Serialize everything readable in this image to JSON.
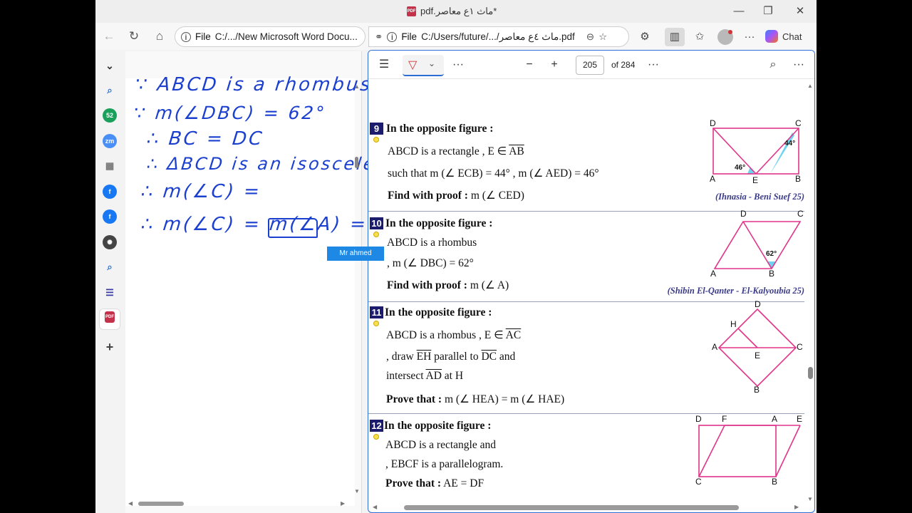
{
  "window": {
    "title": "pdf.ماث ١ع معاصر*",
    "controls": {
      "minimize": "—",
      "restore": "❐",
      "close": "✕"
    }
  },
  "tabs": {
    "left": {
      "scheme": "File",
      "address": "C:/.../New Microsoft Word Docu..."
    },
    "right": {
      "scheme": "File",
      "address": "C:/Users/future/.../ماث ٤ع معاصر.pdf"
    }
  },
  "toolbar": {
    "chat_label": "Chat"
  },
  "sidebar": {
    "items": [
      {
        "icon": "search-icon",
        "color": "#2b6fd6"
      },
      {
        "icon": "badge-52-icon",
        "text": "52",
        "color": "#1aa05b"
      },
      {
        "icon": "zoom-icon",
        "text": "zm",
        "color": "#4a8ff7"
      },
      {
        "icon": "calendar-icon",
        "color": "#777777"
      },
      {
        "icon": "facebook-icon",
        "text": "f",
        "color": "#1877f2"
      },
      {
        "icon": "facebook-icon",
        "text": "f",
        "color": "#1877f2"
      },
      {
        "icon": "chatgpt-icon",
        "text": "✺",
        "color": "#444444"
      },
      {
        "icon": "search-icon",
        "color": "#2b6fd6"
      },
      {
        "icon": "list-icon",
        "color": "#3b3ba8"
      },
      {
        "icon": "pdf-icon",
        "text": "PDF",
        "color": "#c4314b"
      }
    ],
    "add": "+"
  },
  "notes": {
    "lines": [
      "∵ ABCD is a rhombus",
      "∵ m(∠DBC) = 62°",
      "∴ BC = DC",
      "∴ ΔBCD is an isosceles",
      "∴ m(∠C) =",
      "∴ m(∠C) = m(∠A) ="
    ],
    "tag": "Mr ahmed"
  },
  "pdf": {
    "page_number": "205",
    "of_pages": "of 284"
  },
  "problems": [
    {
      "num": "9",
      "heading": "In the opposite figure :",
      "line1": "ABCD is a rectangle",
      "line1b_pre": ", E ∈ ",
      "line1b_seg": "AB",
      "line2": "such that m (∠ ECB) = 44° , m (∠ AED) = 46°",
      "find_label": "Find with proof :",
      "find_text": "m (∠ CED)",
      "source": "(Ihnasia - Beni Suef 25)",
      "fig_labels": {
        "D": "D",
        "C": "C",
        "A": "A",
        "E": "E",
        "B": "B",
        "a1": "44°",
        "a2": "46°"
      }
    },
    {
      "num": "10",
      "heading": "In the opposite figure :",
      "line1": "ABCD is a rhombus",
      "line2": ", m (∠ DBC) = 62°",
      "find_label": "Find with proof :",
      "find_text": "m (∠ A)",
      "source": "(Shibin El-Qanter - El-Kalyoubia 25)",
      "fig_labels": {
        "D": "D",
        "C": "C",
        "A": "A",
        "B": "B",
        "a1": "62°"
      }
    },
    {
      "num": "11",
      "heading": "In the opposite figure :",
      "line1": "ABCD is a rhombus",
      "line1b_pre": ", E ∈ ",
      "line1b_seg": "AC",
      "line2_pre": ", draw ",
      "line2_seg1": "EH",
      "line2_mid": " parallel to ",
      "line2_seg2": "DC",
      "line2_post": " and",
      "line3_pre": "intersect ",
      "line3_seg": "AD",
      "line3_post": " at H",
      "prove_label": "Prove that :",
      "prove_text": "m (∠ HEA) = m (∠ HAE)",
      "fig_labels": {
        "D": "D",
        "H": "H",
        "A": "A",
        "E": "E",
        "C": "C",
        "B": "B"
      }
    },
    {
      "num": "12",
      "heading": "In the opposite figure :",
      "line1": "ABCD is a rectangle and",
      "line2": ", EBCF is a parallelogram.",
      "prove_label": "Prove that :",
      "prove_text": "AE = DF",
      "fig_labels": {
        "D": "D",
        "F": "F",
        "A": "A",
        "E": "E",
        "C": "C",
        "B": "B"
      }
    }
  ],
  "colors": {
    "accent": "#2b6fd6",
    "ink": "#1b3fcf",
    "figure": "#e0348a",
    "angle": "#6fd3f0"
  }
}
